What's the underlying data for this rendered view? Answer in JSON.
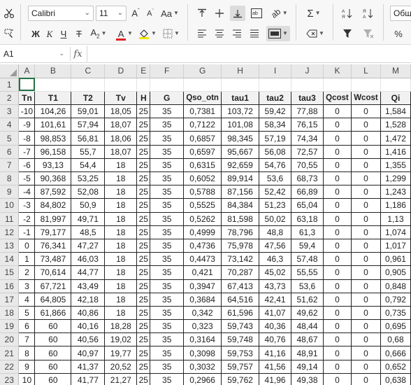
{
  "toolbar": {
    "font_name": "Calibri",
    "font_size": "11",
    "number_format": "Общ"
  },
  "formula_bar": {
    "cell_ref": "A1",
    "fx_label": "fx",
    "content": ""
  },
  "columns": [
    "A",
    "B",
    "C",
    "D",
    "E",
    "F",
    "G",
    "H",
    "I",
    "J",
    "K",
    "L",
    "M"
  ],
  "row_numbers": [
    "1",
    "2",
    "3",
    "4",
    "5",
    "6",
    "7",
    "8",
    "9",
    "10",
    "11",
    "12",
    "13",
    "14",
    "15",
    "16",
    "17",
    "18",
    "19",
    "20",
    "21",
    "22",
    "23"
  ],
  "header_row": [
    "Tn",
    "T1",
    "T2",
    "Tv",
    "H",
    "G",
    "Qso_otn",
    "tau1",
    "tau2",
    "tau3",
    "Qcost",
    "Wcost",
    "Qi"
  ],
  "rows": [
    [
      "-10",
      "104,26",
      "59,01",
      "18,05",
      "25",
      "35",
      "0,7381",
      "103,72",
      "59,42",
      "77,88",
      "0",
      "0",
      "1,584"
    ],
    [
      "-9",
      "101,61",
      "57,94",
      "18,07",
      "25",
      "35",
      "0,7122",
      "101,08",
      "58,34",
      "76,15",
      "0",
      "0",
      "1,528"
    ],
    [
      "-8",
      "98,853",
      "56,81",
      "18,06",
      "25",
      "35",
      "0,6857",
      "98,345",
      "57,19",
      "74,34",
      "0",
      "0",
      "1,472"
    ],
    [
      "-7",
      "96,158",
      "55,7",
      "18,07",
      "25",
      "35",
      "0,6597",
      "95,667",
      "56,08",
      "72,57",
      "0",
      "0",
      "1,416"
    ],
    [
      "-6",
      "93,13",
      "54,4",
      "18",
      "25",
      "35",
      "0,6315",
      "92,659",
      "54,76",
      "70,55",
      "0",
      "0",
      "1,355"
    ],
    [
      "-5",
      "90,368",
      "53,25",
      "18",
      "25",
      "35",
      "0,6052",
      "89,914",
      "53,6",
      "68,73",
      "0",
      "0",
      "1,299"
    ],
    [
      "-4",
      "87,592",
      "52,08",
      "18",
      "25",
      "35",
      "0,5788",
      "87,156",
      "52,42",
      "66,89",
      "0",
      "0",
      "1,243"
    ],
    [
      "-3",
      "84,802",
      "50,9",
      "18",
      "25",
      "35",
      "0,5525",
      "84,384",
      "51,23",
      "65,04",
      "0",
      "0",
      "1,186"
    ],
    [
      "-2",
      "81,997",
      "49,71",
      "18",
      "25",
      "35",
      "0,5262",
      "81,598",
      "50,02",
      "63,18",
      "0",
      "0",
      "1,13"
    ],
    [
      "-1",
      "79,177",
      "48,5",
      "18",
      "25",
      "35",
      "0,4999",
      "78,796",
      "48,8",
      "61,3",
      "0",
      "0",
      "1,074"
    ],
    [
      "0",
      "76,341",
      "47,27",
      "18",
      "25",
      "35",
      "0,4736",
      "75,978",
      "47,56",
      "59,4",
      "0",
      "0",
      "1,017"
    ],
    [
      "1",
      "73,487",
      "46,03",
      "18",
      "25",
      "35",
      "0,4473",
      "73,142",
      "46,3",
      "57,48",
      "0",
      "0",
      "0,961"
    ],
    [
      "2",
      "70,614",
      "44,77",
      "18",
      "25",
      "35",
      "0,421",
      "70,287",
      "45,02",
      "55,55",
      "0",
      "0",
      "0,905"
    ],
    [
      "3",
      "67,721",
      "43,49",
      "18",
      "25",
      "35",
      "0,3947",
      "67,413",
      "43,73",
      "53,6",
      "0",
      "0",
      "0,848"
    ],
    [
      "4",
      "64,805",
      "42,18",
      "18",
      "25",
      "35",
      "0,3684",
      "64,516",
      "42,41",
      "51,62",
      "0",
      "0",
      "0,792"
    ],
    [
      "5",
      "61,866",
      "40,86",
      "18",
      "25",
      "35",
      "0,342",
      "61,596",
      "41,07",
      "49,62",
      "0",
      "0",
      "0,735"
    ],
    [
      "6",
      "60",
      "40,16",
      "18,28",
      "25",
      "35",
      "0,323",
      "59,743",
      "40,36",
      "48,44",
      "0",
      "0",
      "0,695"
    ],
    [
      "7",
      "60",
      "40,56",
      "19,02",
      "25",
      "35",
      "0,3164",
      "59,748",
      "40,76",
      "48,67",
      "0",
      "0",
      "0,68"
    ],
    [
      "8",
      "60",
      "40,97",
      "19,77",
      "25",
      "35",
      "0,3098",
      "59,753",
      "41,16",
      "48,91",
      "0",
      "0",
      "0,666"
    ],
    [
      "9",
      "60",
      "41,37",
      "20,52",
      "25",
      "35",
      "0,3032",
      "59,757",
      "41,56",
      "49,14",
      "0",
      "0",
      "0,652"
    ],
    [
      "10",
      "60",
      "41,77",
      "21,27",
      "25",
      "35",
      "0,2966",
      "59,762",
      "41,96",
      "49,38",
      "0",
      "0",
      "0,638"
    ]
  ],
  "colors": {
    "selection": "#217346",
    "font_color_bar": "#e02020",
    "fill_color_bar": "#f5e400"
  }
}
